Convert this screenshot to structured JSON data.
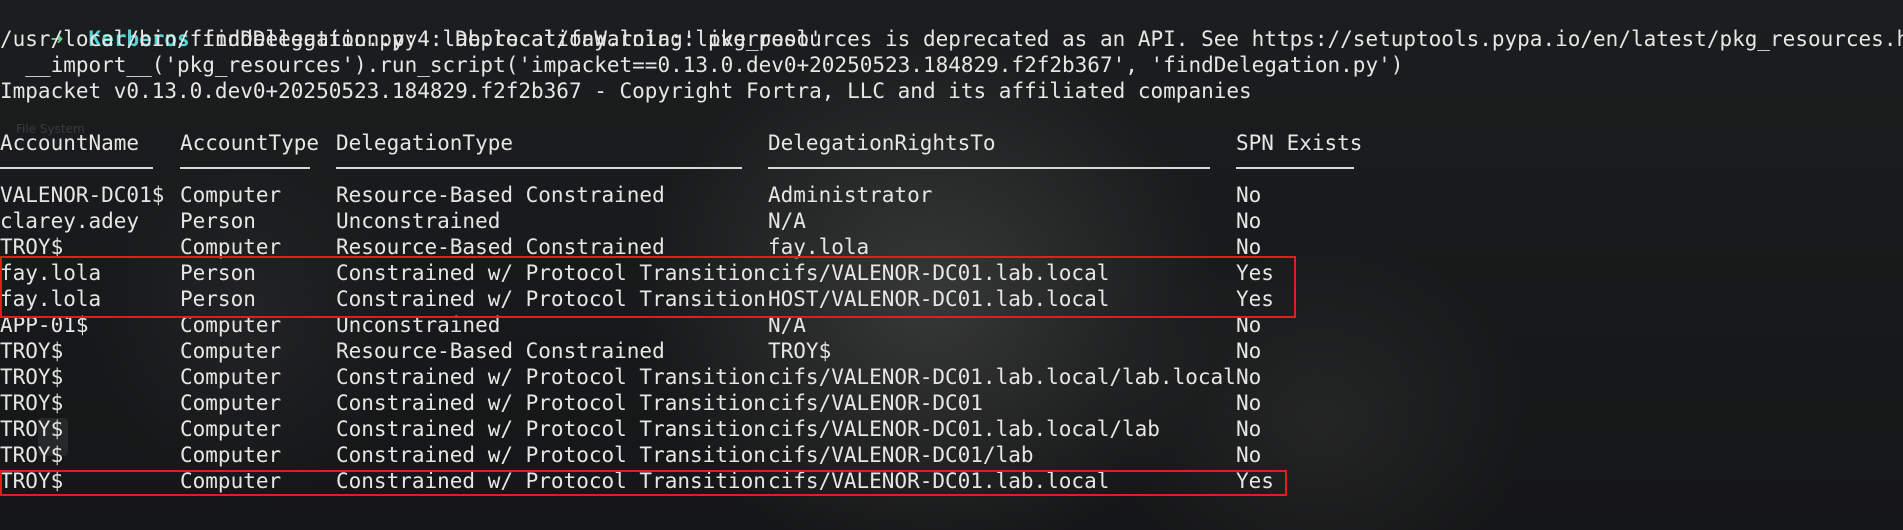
{
  "prompt": {
    "arrow": "➜",
    "host": "Kerberos",
    "command": "findDelegation.py  lab.local/fay.lola:'liverpool'"
  },
  "output_lines": [
    "/usr/local/bin/findDelegation.py:4: DeprecationWarning: pkg_resources is deprecated as an API. See https://setuptools.pypa.io/en/latest/pkg_resources.html",
    "  __import__('pkg_resources').run_script('impacket==0.13.0.dev0+20250523.184829.f2f2b367', 'findDelegation.py')",
    "Impacket v0.13.0.dev0+20250523.184829.f2f2b367 - Copyright Fortra, LLC and its affiliated companies"
  ],
  "table": {
    "headers": [
      "AccountName",
      "AccountType",
      "DelegationType",
      "DelegationRightsTo",
      "SPN Exists"
    ],
    "rows": [
      [
        "VALENOR-DC01$",
        "Computer",
        "Resource-Based Constrained",
        "Administrator",
        "No"
      ],
      [
        "clarey.adey",
        "Person",
        "Unconstrained",
        "N/A",
        "No"
      ],
      [
        "TROY$",
        "Computer",
        "Resource-Based Constrained",
        "fay.lola",
        "No"
      ],
      [
        "fay.lola",
        "Person",
        "Constrained w/ Protocol Transition",
        "cifs/VALENOR-DC01.lab.local",
        "Yes"
      ],
      [
        "fay.lola",
        "Person",
        "Constrained w/ Protocol Transition",
        "HOST/VALENOR-DC01.lab.local",
        "Yes"
      ],
      [
        "APP-01$",
        "Computer",
        "Unconstrained",
        "N/A",
        "No"
      ],
      [
        "TROY$",
        "Computer",
        "Resource-Based Constrained",
        "TROY$",
        "No"
      ],
      [
        "TROY$",
        "Computer",
        "Constrained w/ Protocol Transition",
        "cifs/VALENOR-DC01.lab.local/lab.local",
        "No"
      ],
      [
        "TROY$",
        "Computer",
        "Constrained w/ Protocol Transition",
        "cifs/VALENOR-DC01",
        "No"
      ],
      [
        "TROY$",
        "Computer",
        "Constrained w/ Protocol Transition",
        "cifs/VALENOR-DC01.lab.local/lab",
        "No"
      ],
      [
        "TROY$",
        "Computer",
        "Constrained w/ Protocol Transition",
        "cifs/VALENOR-DC01/lab",
        "No"
      ],
      [
        "TROY$",
        "Computer",
        "Constrained w/ Protocol Transition",
        "cifs/VALENOR-DC01.lab.local",
        "Yes"
      ]
    ]
  },
  "background_labels": {
    "file_system": "File System"
  },
  "colors": {
    "highlight": "#e01e1e",
    "prompt_arrow": "#5fd38d",
    "prompt_host": "#56d6d6"
  }
}
